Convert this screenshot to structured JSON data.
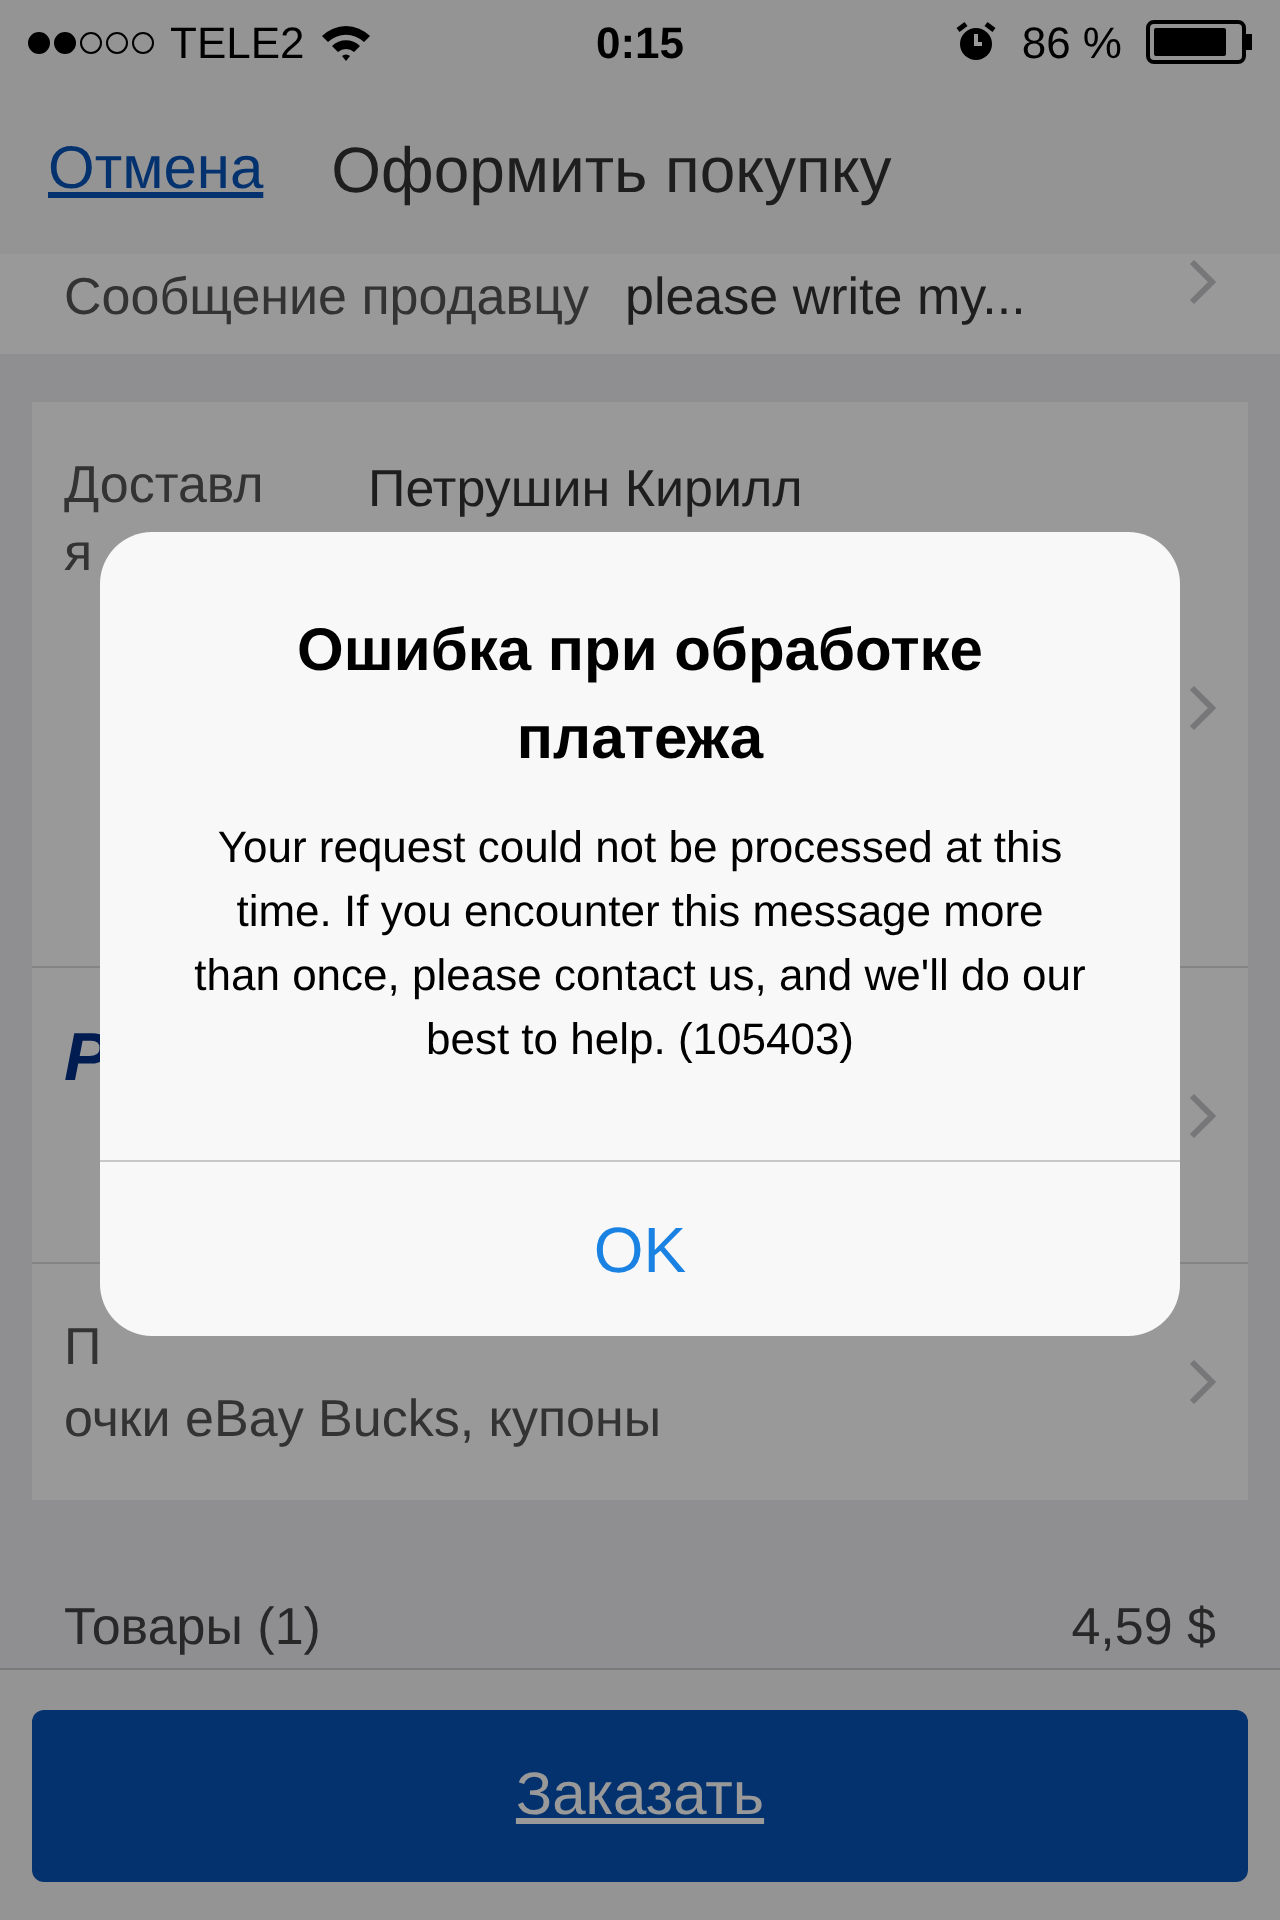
{
  "status_bar": {
    "carrier": "TELE2",
    "time": "0:15",
    "battery": "86 %"
  },
  "nav": {
    "cancel": "Отмена",
    "title": "Оформить покупку"
  },
  "message_row": {
    "label": "Сообщение продавцу",
    "value": "please write my..."
  },
  "shipping": {
    "label_line1": "Доставл",
    "label_line2": "я",
    "name": "Петрушин Кирилл"
  },
  "payment": {
    "logo_letter": "P"
  },
  "coupons": {
    "line1": "П",
    "line2": "очки eBay Bucks, купоны"
  },
  "totals": [
    {
      "label": "Товары (1)",
      "value": "4,59 $"
    }
  ],
  "order_button": "Заказать",
  "alert": {
    "title": "Ошибка при обработке платежа",
    "message": "Your request could not be processed at this time. If you encounter this message more than once, please contact us, and we'll do our best to help. (105403)",
    "button": "OK"
  }
}
